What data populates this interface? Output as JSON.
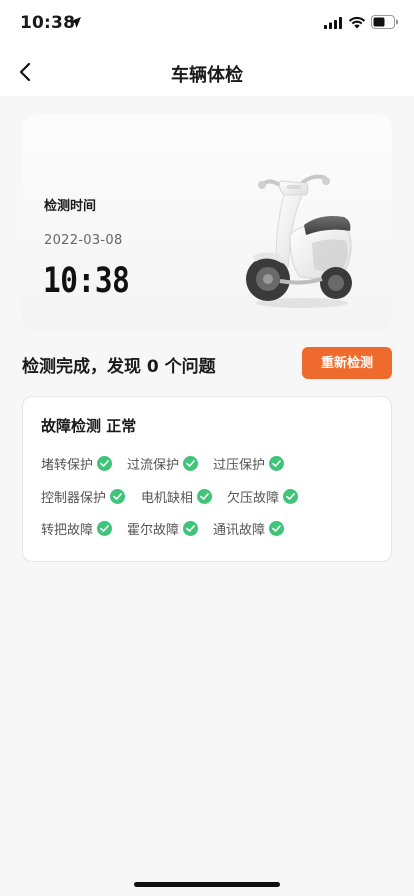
{
  "status_bar": {
    "time": "10:38"
  },
  "nav": {
    "title": "车辆体检"
  },
  "hero": {
    "check_time_label": "检测时间",
    "date": "2022-03-08",
    "time": "10:38"
  },
  "result": {
    "summary": "检测完成，发现 0 个问题",
    "recheck_label": "重新检测"
  },
  "fault_check": {
    "title": "故障检测 正常",
    "items": [
      {
        "label": "堵转保护",
        "status": "ok"
      },
      {
        "label": "过流保护",
        "status": "ok"
      },
      {
        "label": "过压保护",
        "status": "ok"
      },
      {
        "label": "控制器保护",
        "status": "ok"
      },
      {
        "label": "电机缺相",
        "status": "ok"
      },
      {
        "label": "欠压故障",
        "status": "ok"
      },
      {
        "label": "转把故障",
        "status": "ok"
      },
      {
        "label": "霍尔故障",
        "status": "ok"
      },
      {
        "label": "通讯故障",
        "status": "ok"
      }
    ]
  },
  "colors": {
    "accent": "#ef6a2d",
    "ok": "#3fc47a",
    "background": "#f7f7f7"
  }
}
